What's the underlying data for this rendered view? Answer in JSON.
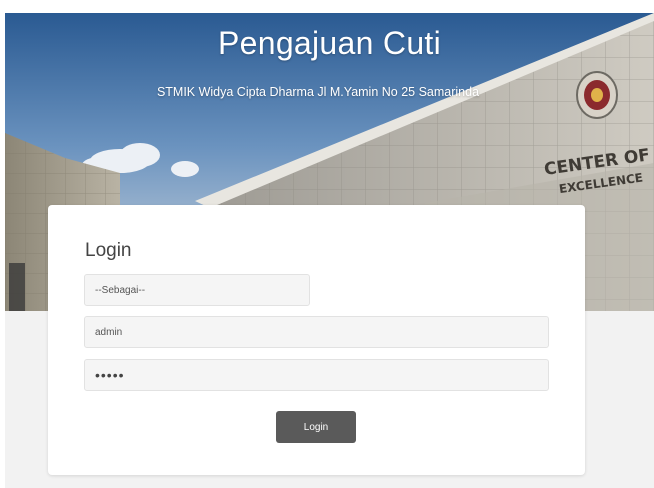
{
  "header": {
    "title": "Pengajuan Cuti",
    "subtitle": "STMIK Widya Cipta Dharma Jl M.Yamin No 25 Samarinda",
    "building_sign_line1": "CENTER OF",
    "building_sign_line2": "EXCELLENCE"
  },
  "login": {
    "title": "Login",
    "role_select_value": "--Sebagai--",
    "username_value": "admin",
    "password_value": "•••••",
    "button_label": "Login"
  },
  "colors": {
    "button_bg": "#5a5a5a",
    "field_bg": "#f5f5f5",
    "page_bg": "#f2f2f2"
  }
}
